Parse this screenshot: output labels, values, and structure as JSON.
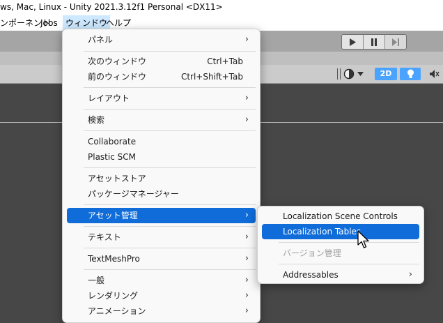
{
  "window": {
    "title": "ws, Mac, Linux - Unity 2021.3.12f1 Personal <DX11>"
  },
  "menubar": {
    "items": [
      {
        "label": "ンポーネント"
      },
      {
        "label": "Jobs"
      },
      {
        "label": "ウィンドウ"
      },
      {
        "label": "ヘルプ"
      }
    ]
  },
  "toolbar": {
    "play_icon": "play-icon",
    "pause_icon": "pause-icon",
    "step_icon": "step-icon"
  },
  "scene_tools": {
    "mode_2d_label": "2D",
    "accent": "#4aa3ff"
  },
  "window_menu": {
    "items": [
      {
        "label": "パネル",
        "submenu": true
      },
      {
        "label": "次のウィンドウ",
        "shortcut": "Ctrl+Tab"
      },
      {
        "label": "前のウィンドウ",
        "shortcut": "Ctrl+Shift+Tab"
      },
      {
        "label": "レイアウト",
        "submenu": true
      },
      {
        "label": "検索",
        "submenu": true
      },
      {
        "label": "Collaborate"
      },
      {
        "label": "Plastic SCM"
      },
      {
        "label": "アセットストア"
      },
      {
        "label": "パッケージマネージャー"
      },
      {
        "label": "アセット管理",
        "submenu": true,
        "highlighted": true
      },
      {
        "label": "テキスト",
        "submenu": true
      },
      {
        "label": "TextMeshPro",
        "submenu": true
      },
      {
        "label": "一般",
        "submenu": true
      },
      {
        "label": "レンダリング",
        "submenu": true
      },
      {
        "label": "アニメーション",
        "submenu": true
      }
    ]
  },
  "asset_submenu": {
    "items": [
      {
        "label": "Localization Scene Controls"
      },
      {
        "label": "Localization Tables",
        "highlighted": true
      },
      {
        "label": "バージョン管理",
        "disabled": true
      },
      {
        "label": "Addressables",
        "submenu": true
      }
    ]
  },
  "colors": {
    "highlight": "#0f6cd9",
    "menu_bg": "#f9f9f9"
  }
}
